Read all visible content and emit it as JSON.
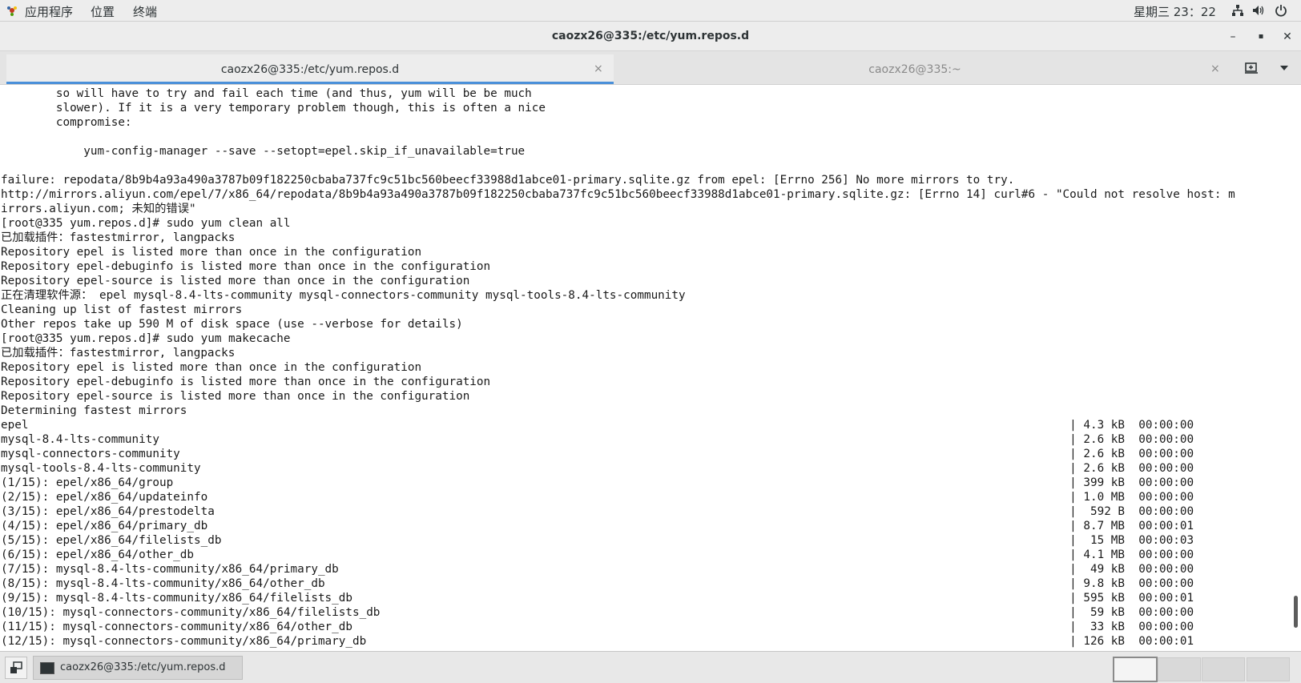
{
  "top_panel": {
    "menus": [
      "应用程序",
      "位置",
      "终端"
    ],
    "clock": "星期三 23：22"
  },
  "window": {
    "title": "caozx26@335:/etc/yum.repos.d",
    "minimize": "–",
    "maximize": "▪",
    "close": "✕"
  },
  "tabs": [
    {
      "label": "caozx26@335:/etc/yum.repos.d",
      "close": "×"
    },
    {
      "label": "caozx26@335:~",
      "close": "×"
    }
  ],
  "terminal": {
    "lines": [
      "        so will have to try and fail each time (and thus, yum will be be much",
      "        slower). If it is a very temporary problem though, this is often a nice",
      "        compromise:",
      "",
      "            yum-config-manager --save --setopt=epel.skip_if_unavailable=true",
      "",
      "failure: repodata/8b9b4a93a490a3787b09f182250cbaba737fc9c51bc560beecf33988d1abce01-primary.sqlite.gz from epel: [Errno 256] No more mirrors to try.",
      "http://mirrors.aliyun.com/epel/7/x86_64/repodata/8b9b4a93a490a3787b09f182250cbaba737fc9c51bc560beecf33988d1abce01-primary.sqlite.gz: [Errno 14] curl#6 - \"Could not resolve host: m",
      "irrors.aliyun.com; 未知的错误\"",
      "[root@335 yum.repos.d]# sudo yum clean all",
      "已加载插件：fastestmirror, langpacks",
      "Repository epel is listed more than once in the configuration",
      "Repository epel-debuginfo is listed more than once in the configuration",
      "Repository epel-source is listed more than once in the configuration",
      "正在清理软件源： epel mysql-8.4-lts-community mysql-connectors-community mysql-tools-8.4-lts-community",
      "Cleaning up list of fastest mirrors",
      "Other repos take up 590 M of disk space (use --verbose for details)",
      "[root@335 yum.repos.d]# sudo yum makecache",
      "已加载插件：fastestmirror, langpacks",
      "Repository epel is listed more than once in the configuration",
      "Repository epel-debuginfo is listed more than once in the configuration",
      "Repository epel-source is listed more than once in the configuration",
      "Determining fastest mirrors",
      "epel                                                                                                                                                       | 4.3 kB  00:00:00",
      "mysql-8.4-lts-community                                                                                                                                    | 2.6 kB  00:00:00",
      "mysql-connectors-community                                                                                                                                 | 2.6 kB  00:00:00",
      "mysql-tools-8.4-lts-community                                                                                                                              | 2.6 kB  00:00:00",
      "(1/15): epel/x86_64/group                                                                                                                                  | 399 kB  00:00:00",
      "(2/15): epel/x86_64/updateinfo                                                                                                                             | 1.0 MB  00:00:00",
      "(3/15): epel/x86_64/prestodelta                                                                                                                            |  592 B  00:00:00",
      "(4/15): epel/x86_64/primary_db                                                                                                                             | 8.7 MB  00:00:01",
      "(5/15): epel/x86_64/filelists_db                                                                                                                           |  15 MB  00:00:03",
      "(6/15): epel/x86_64/other_db                                                                                                                               | 4.1 MB  00:00:00",
      "(7/15): mysql-8.4-lts-community/x86_64/primary_db                                                                                                          |  49 kB  00:00:00",
      "(8/15): mysql-8.4-lts-community/x86_64/other_db                                                                                                            | 9.8 kB  00:00:00",
      "(9/15): mysql-8.4-lts-community/x86_64/filelists_db                                                                                                        | 595 kB  00:00:01",
      "(10/15): mysql-connectors-community/x86_64/filelists_db                                                                                                    |  59 kB  00:00:00",
      "(11/15): mysql-connectors-community/x86_64/other_db                                                                                                        |  33 kB  00:00:00",
      "(12/15): mysql-connectors-community/x86_64/primary_db                                                                                                      | 126 kB  00:00:01"
    ]
  },
  "taskbar": {
    "task_label": "caozx26@335:/etc/yum.repos.d"
  },
  "colors": {
    "accent": "#4a90d9",
    "terminal_bg": "#ffffff",
    "terminal_fg": "#1a1a1a"
  }
}
